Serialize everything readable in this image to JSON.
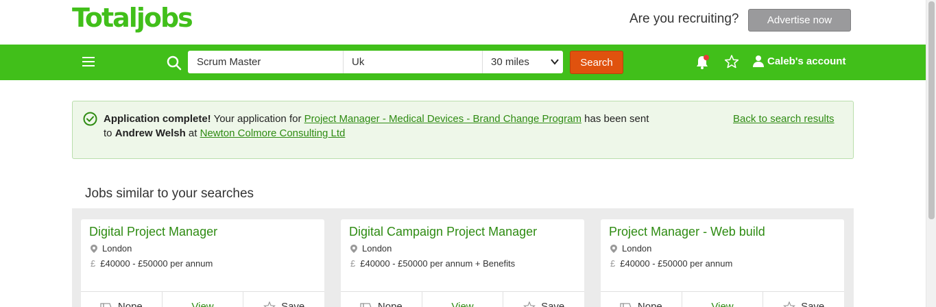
{
  "header": {
    "logo": "Totaljobs",
    "recruit_text": "Are you recruiting?",
    "advertise_label": "Advertise now"
  },
  "nav": {
    "keyword_value": "Scrum Master",
    "location_value": "Uk",
    "radius_value": "30 miles",
    "search_label": "Search",
    "account_label": "Caleb's account",
    "notification_dot_color": "#e63939"
  },
  "banner": {
    "strong": "Application complete!",
    "text1": " Your application for ",
    "job_link": "Project Manager - Medical Devices - Brand Change Program",
    "text2": " has been sent to ",
    "recipient": "Andrew Welsh",
    "text3": " at ",
    "company_link": "Newton Colmore Consulting Ltd",
    "back_link": "Back to search results"
  },
  "similar": {
    "title": "Jobs similar to your searches",
    "jobs": [
      {
        "title": "Digital Project Manager",
        "location": "London",
        "salary": "£40000 - £50000 per annum",
        "nope": "Nope",
        "view": "View",
        "save": "Save"
      },
      {
        "title": "Digital Campaign Project Manager",
        "location": "London",
        "salary": "£40000 - £50000 per annum + Benefits",
        "nope": "Nope",
        "view": "View",
        "save": "Save"
      },
      {
        "title": "Project Manager - Web build",
        "location": "London",
        "salary": "£40000 - £50000 per annum",
        "nope": "Nope",
        "view": "View",
        "save": "Save"
      }
    ]
  },
  "colors": {
    "brand_green": "#41bf1a",
    "search_orange": "#e0520e",
    "link_green": "#2e8b12"
  }
}
